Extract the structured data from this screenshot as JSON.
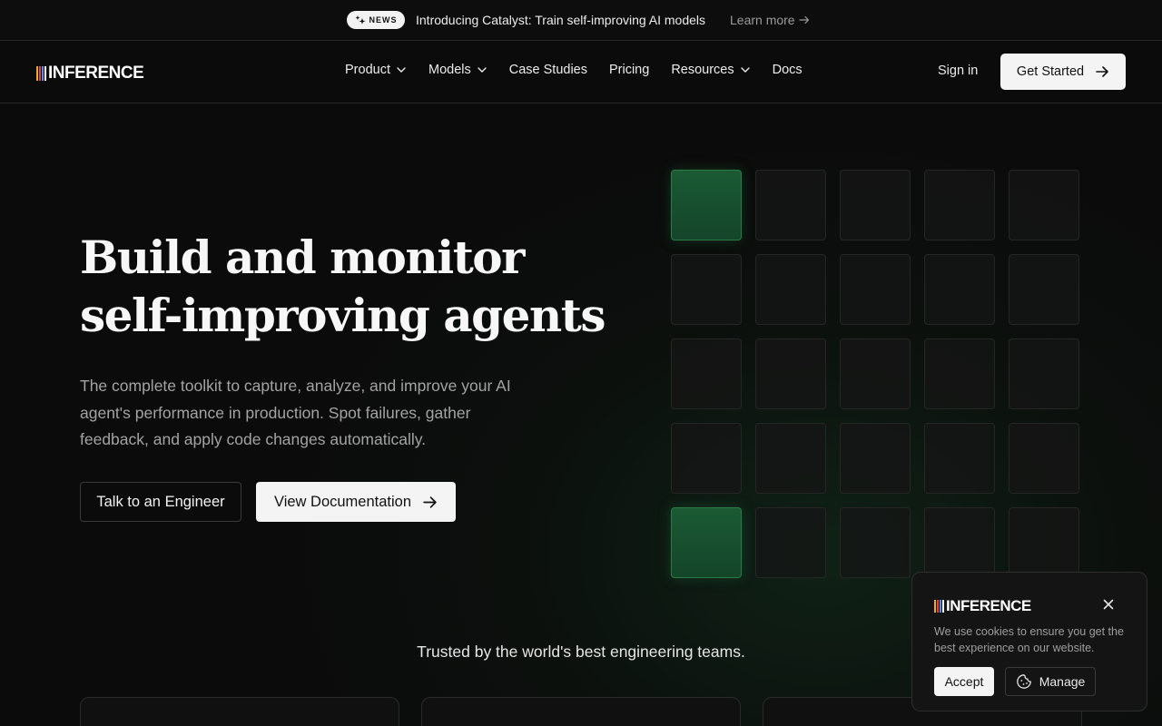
{
  "announcement": {
    "badge": "NEWS",
    "text": "Introducing Catalyst: Train self-improving AI models",
    "link": "Learn more"
  },
  "brand": {
    "name": "INFERENCE",
    "stripe_colors": [
      "#f5a623",
      "#e0453a",
      "#5b8def",
      "#ffffff"
    ]
  },
  "nav": {
    "items": [
      {
        "label": "Product",
        "dropdown": true
      },
      {
        "label": "Models",
        "dropdown": true
      },
      {
        "label": "Case Studies",
        "dropdown": false
      },
      {
        "label": "Pricing",
        "dropdown": false
      },
      {
        "label": "Resources",
        "dropdown": true
      },
      {
        "label": "Docs",
        "dropdown": false
      }
    ],
    "sign_in": "Sign in",
    "get_started": "Get Started"
  },
  "hero": {
    "title_line1": "Build and monitor",
    "title_line2": "self-improving agents",
    "subtitle": "The complete toolkit to capture, analyze, and improve your AI agent's performance in production. Spot failures, gather feedback, and apply code changes automatically.",
    "primary_cta": "Talk to an Engineer",
    "secondary_cta": "View Documentation"
  },
  "grid": {
    "rows": 5,
    "cols": 5,
    "active_cells": [
      0,
      20
    ],
    "accent_color": "#1a5a33"
  },
  "trusted": {
    "text": "Trusted by the world's best engineering teams."
  },
  "cookie": {
    "brand": "INFERENCE",
    "text": "We use cookies to ensure you get the best experience on our website.",
    "accept": "Accept",
    "manage": "Manage"
  }
}
